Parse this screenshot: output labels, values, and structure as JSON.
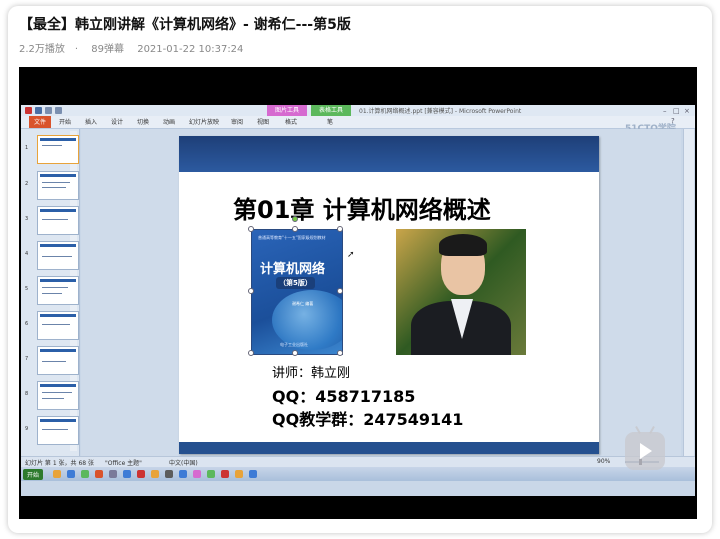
{
  "video": {
    "title": "【最全】韩立刚讲解《计算机网络》- 谢希仁---第5版",
    "views": "2.2万播放",
    "danmaku": "89弹幕",
    "date": "2021-01-22 10:37:24"
  },
  "ppt": {
    "contextual_tab_1": "图片工具",
    "contextual_tab_2": "表格工具",
    "document_title": "01.计算机网络概述.ppt [兼容模式] - Microsoft PowerPoint",
    "watermark": "51CTO学院",
    "ribbon_tabs": [
      "文件",
      "开始",
      "插入",
      "设计",
      "切换",
      "动画",
      "幻灯片放映",
      "审阅",
      "视图",
      "格式",
      "笔"
    ],
    "thumb_numbers": [
      "1",
      "2",
      "3",
      "4",
      "5",
      "6",
      "7",
      "8",
      "9"
    ],
    "status_slide": "幻灯片 第 1 张，共 68 张",
    "status_theme": "\"Office 主题\"",
    "status_lang": "中文(中国)",
    "zoom": "90%",
    "taskbar_start": "开始"
  },
  "slide": {
    "heading": "第01章 计算机网络概述",
    "book_series": "普通高等教育\"十一五\"国家级规划教材",
    "book_title": "计算机网络",
    "book_edition": "（第5版）",
    "book_author": "谢希仁 编著",
    "book_publisher": "电子工业出版社",
    "lecturer": "讲师：韩立刚",
    "qq": "QQ：458717185",
    "qq_group": "QQ教学群：247549141"
  },
  "colors": {
    "slide_band": "#25508f",
    "file_tab": "#d9532b",
    "context_tab_1": "#d66ad0",
    "context_tab_2": "#5cb85c"
  }
}
